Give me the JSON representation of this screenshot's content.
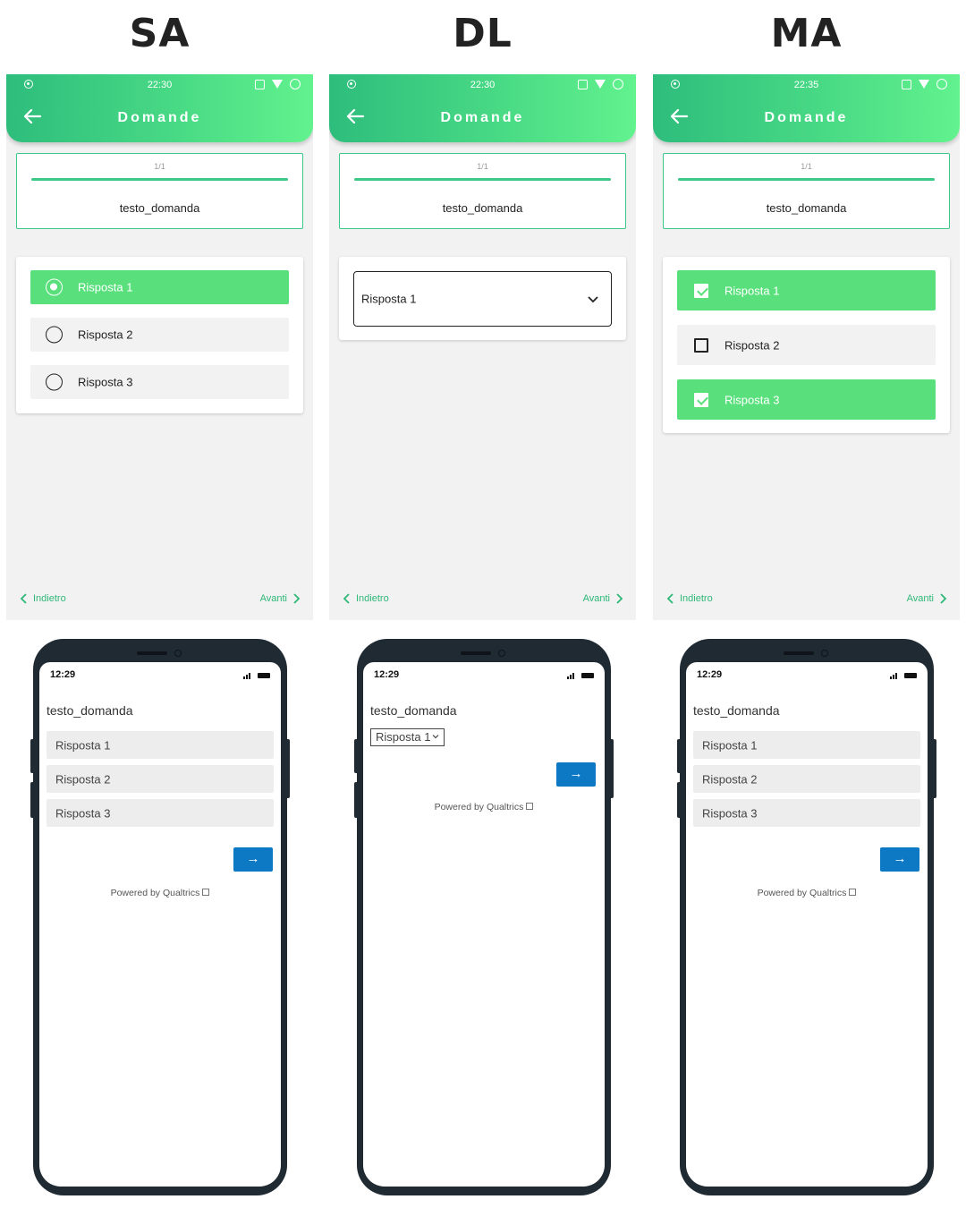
{
  "columns": [
    {
      "label": "SA",
      "app": {
        "time": "22:30",
        "title": "Domande",
        "counter": "1/1",
        "question": "testo_domanda",
        "options": [
          {
            "label": "Risposta 1",
            "selected": true
          },
          {
            "label": "Risposta 2",
            "selected": false
          },
          {
            "label": "Risposta 3",
            "selected": false
          }
        ],
        "back": "Indietro",
        "next": "Avanti"
      },
      "phone": {
        "time": "12:29",
        "question": "testo_domanda",
        "options": [
          "Risposta 1",
          "Risposta 2",
          "Risposta 3"
        ],
        "next_arrow": "→",
        "powered": "Powered by Qualtrics"
      }
    },
    {
      "label": "DL",
      "app": {
        "time": "22:30",
        "title": "Domande",
        "counter": "1/1",
        "question": "testo_domanda",
        "dropdown_value": "Risposta 1",
        "back": "Indietro",
        "next": "Avanti"
      },
      "phone": {
        "time": "12:29",
        "question": "testo_domanda",
        "select_value": "Risposta 1",
        "next_arrow": "→",
        "powered": "Powered by Qualtrics"
      }
    },
    {
      "label": "MA",
      "app": {
        "time": "22:35",
        "title": "Domande",
        "counter": "1/1",
        "question": "testo_domanda",
        "options": [
          {
            "label": "Risposta 1",
            "selected": true
          },
          {
            "label": "Risposta 2",
            "selected": false
          },
          {
            "label": "Risposta 3",
            "selected": true
          }
        ],
        "back": "Indietro",
        "next": "Avanti"
      },
      "phone": {
        "time": "12:29",
        "question": "testo_domanda",
        "options": [
          "Risposta 1",
          "Risposta 2",
          "Risposta 3"
        ],
        "next_arrow": "→",
        "powered": "Powered by Qualtrics"
      }
    }
  ],
  "colors": {
    "accent_green": "#59e07c",
    "header_gradient_start": "#2ebd7c",
    "header_gradient_end": "#62f28e",
    "qualtrics_blue": "#0d78c3",
    "phone_frame": "#1f2a33"
  },
  "icons": [
    "back-arrow-icon",
    "chevron-left-icon",
    "chevron-right-icon",
    "chevron-down-icon",
    "radio-icon",
    "checkbox-icon",
    "wifi-icon",
    "vibrate-icon",
    "battery-icon",
    "external-link-icon"
  ]
}
